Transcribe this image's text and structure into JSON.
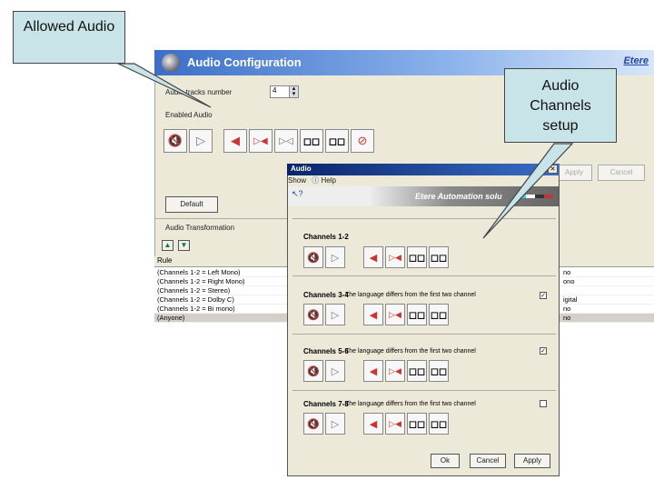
{
  "main": {
    "title": "Audio Configuration",
    "logo": "Etere",
    "tracks_label": "Audio tracks number",
    "tracks_value": "4",
    "enabled_label": "Enabled Audio",
    "default_btn": "Default",
    "transform_label": "Audio Transformation",
    "apply_btn": "Apply",
    "cancel_btn": "Cancel",
    "table_header": "Rule",
    "rules": [
      {
        "rule": "(Channels 1-2 = Left Mono)",
        "right": "no"
      },
      {
        "rule": "(Channels 1-2 = Right Mono)",
        "right": "ono"
      },
      {
        "rule": "(Channels 1-2 = Stereo)",
        "right": ""
      },
      {
        "rule": "(Channels 1-2 = Dolby C)",
        "right": "igital"
      },
      {
        "rule": "(Channels 1-2 = Bi mono)",
        "right": "no"
      },
      {
        "rule": "(Anyone)",
        "right": "no"
      }
    ]
  },
  "dialog": {
    "title": "Audio",
    "menu_show": "Show",
    "menu_help": "Help",
    "banner": "Etere Automation solu",
    "channel_groups": [
      {
        "label": "Channels 1-2",
        "note": "",
        "checked": ""
      },
      {
        "label": "Channels 3-4",
        "note": "The language differs from the first two channel",
        "checked": "✓"
      },
      {
        "label": "Channels 5-6",
        "note": "The language differs from the first two channel",
        "checked": "✓"
      },
      {
        "label": "Channels 7-8",
        "note": "The language differs from the first two channel",
        "checked": ""
      }
    ],
    "ok_btn": "Ok",
    "cancel_btn": "Cancel",
    "apply_btn": "Apply"
  },
  "callouts": {
    "allowed_audio": "Allowed Audio",
    "channels_setup": "Audio Channels setup"
  }
}
